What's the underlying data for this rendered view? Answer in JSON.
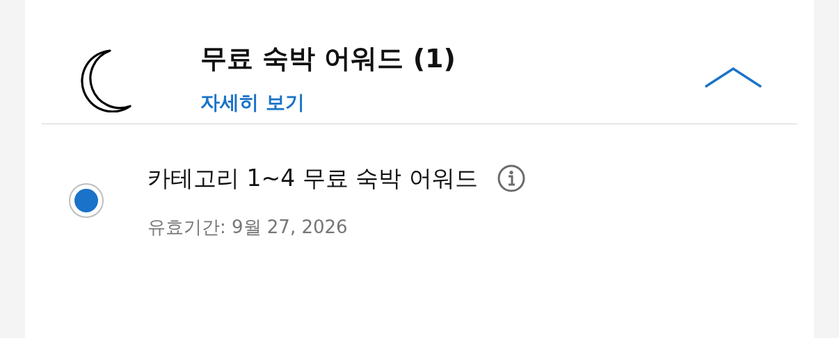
{
  "section": {
    "title": "무료 숙박 어워드 (1)",
    "details_link": "자세히 보기",
    "expanded": true
  },
  "options": [
    {
      "label": "카테고리 1~4 무료 숙박 어워드",
      "validity": "유효기간: 9월 27, 2026",
      "selected": true
    }
  ]
}
